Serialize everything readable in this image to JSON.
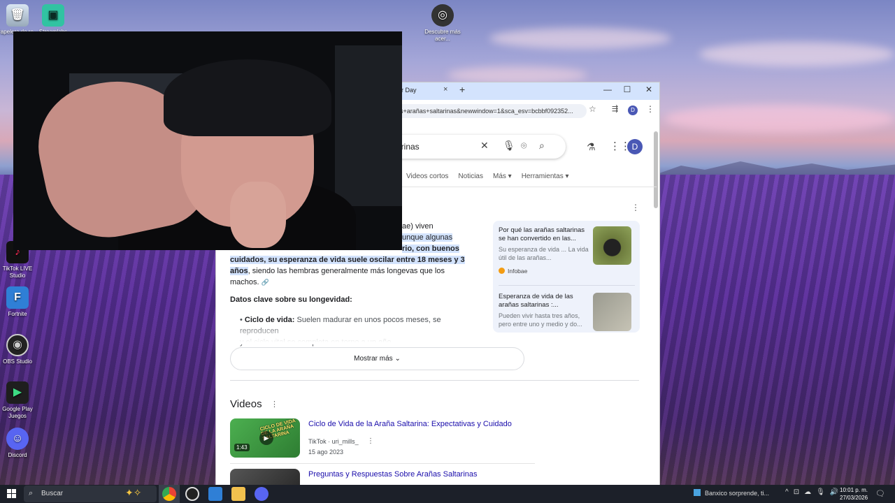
{
  "desktop": {
    "icons": [
      {
        "label": "Papelera de reciclaje",
        "short": "Papelera de re..."
      },
      {
        "label": "Streamlabs",
        "short": "Streamlabs"
      },
      {
        "label": "Descubre más acerca...",
        "short": "Descubre más acer..."
      },
      {
        "label": "TikTok LIVE Studio",
        "short": "TikTok LIVE Studio"
      },
      {
        "label": "Fortnite",
        "short": "Fortnite"
      },
      {
        "label": "OBS Studio",
        "short": "OBS Studio"
      },
      {
        "label": "Google Play Juegos",
        "short": "Google Play Juegos"
      },
      {
        "label": "Discord",
        "short": "Discord"
      }
    ]
  },
  "browser": {
    "tab_title": "ur Day",
    "url": "as+arañas+saltarinas&newwindow=1&sca_esv=bcbbf092352...",
    "profile_initial": "D",
    "search_query": "arinas",
    "nav_tabs": [
      "Videos cortos",
      "Noticias",
      "Más",
      "Herramientas"
    ],
    "answer": {
      "line1_tail": "ae) viven",
      "hl1": "unque algunas",
      "hl2": "rio, con buenos",
      "hl3": "cuidados, su esperanza de vida suele oscilar entre 18 meses y 3",
      "hl4": "años",
      "rest1": ", siendo las hembras generalmente más longevas que los",
      "rest2": "machos."
    },
    "key_facts_title": "Datos clave sobre su longevidad:",
    "bullet": {
      "label": "Ciclo de vida:",
      "text": "Suelen madurar en unos pocos meses, se reproducen",
      "text2": "y el ciclo vital se completa en torno a un año."
    },
    "cards": [
      {
        "title": "Por qué las arañas saltarinas se han convertido en las...",
        "snippet": "Su esperanza de vida ... La vida útil de las arañas...",
        "source": "Infobae"
      },
      {
        "title": "Esperanza de vida de las arañas saltarinas :...",
        "snippet": "Pueden vivir hasta tres años, pero entre uno y medio y do..."
      }
    ],
    "show_more": "Mostrar más",
    "videos_heading": "Videos",
    "videos": [
      {
        "title": "Ciclo de Vida de la Araña Saltarina: Expectativas y Cuidado",
        "platform": "TikTok",
        "author": "uri_mills_",
        "date": "15 ago 2023",
        "duration": "1:43",
        "thumb_caption": "CICLO DE VIDA DE LA ARAÑA SALTARINA"
      },
      {
        "title": "Preguntas y Respuestas Sobre Arañas Saltarinas"
      }
    ]
  },
  "taskbar": {
    "search_placeholder": "Buscar",
    "news": "Banxico sorprende, ti...",
    "time": "10:01 p. m.",
    "date": "27/03/2026"
  }
}
